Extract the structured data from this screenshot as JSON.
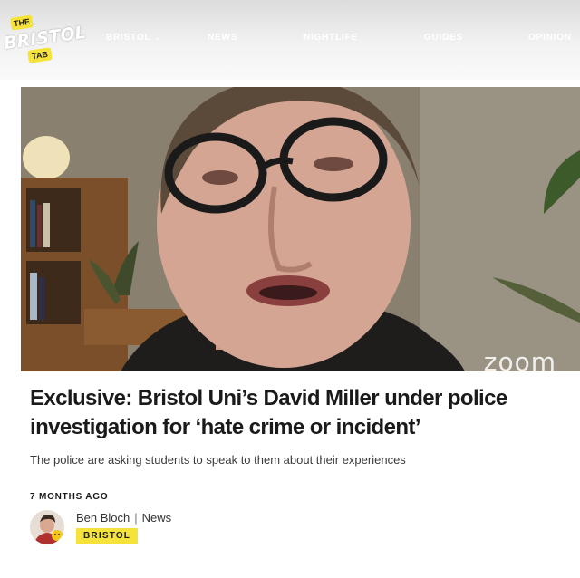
{
  "site": {
    "logo_top": "THE",
    "logo_name": "BRISTOL",
    "logo_bottom": "TAB"
  },
  "nav": {
    "items": [
      {
        "label": "BRISTOL",
        "has_dropdown": true
      },
      {
        "label": "NEWS"
      },
      {
        "label": "NIGHTLIFE"
      },
      {
        "label": "GUIDES"
      },
      {
        "label": "OPINION"
      }
    ]
  },
  "hero": {
    "watermark": "zoom"
  },
  "article": {
    "headline": "Exclusive: Bristol Uni’s David Miller under police investigation for ‘hate crime or incident’",
    "standfirst": "The police are asking students to speak to them about their experiences",
    "time_ago": "7 MONTHS AGO",
    "author": "Ben Bloch",
    "separator": "|",
    "section": "News",
    "tag": "BRISTOL"
  },
  "colors": {
    "accent_yellow": "#f5e23a",
    "text_dark": "#1a1a1a"
  }
}
